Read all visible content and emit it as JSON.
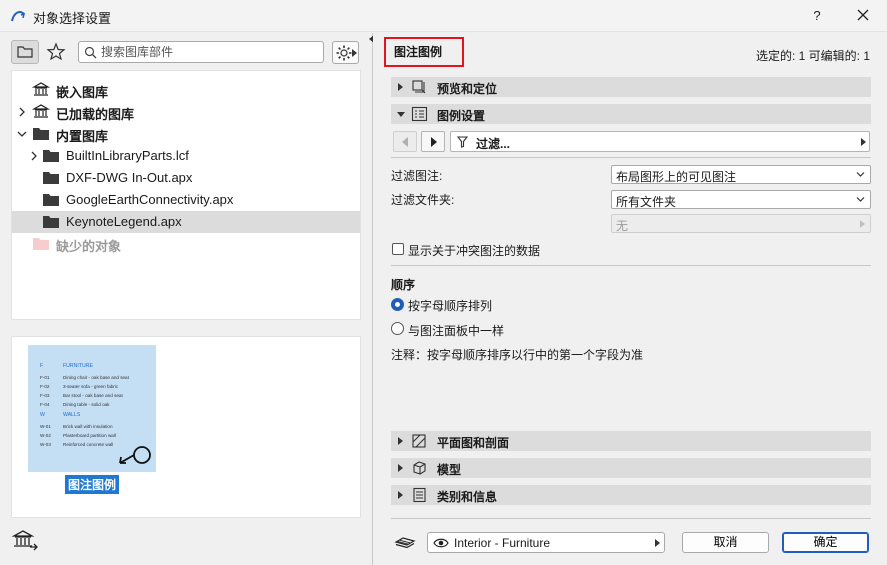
{
  "window": {
    "title": "对象选择设置",
    "help_label": "?"
  },
  "search": {
    "placeholder": "搜索图库部件"
  },
  "tree": {
    "items": [
      {
        "label": "嵌入图库",
        "style": "bold"
      },
      {
        "label": "已加载的图库",
        "style": "bold"
      },
      {
        "label": "内置图库",
        "style": "bold"
      },
      {
        "label": "BuiltInLibraryParts.lcf",
        "style": "normal"
      },
      {
        "label": "DXF-DWG In-Out.apx",
        "style": "normal"
      },
      {
        "label": "GoogleEarthConnectivity.apx",
        "style": "normal"
      },
      {
        "label": "KeynoteLegend.apx",
        "style": "normal"
      },
      {
        "label": "缺少的对象",
        "style": "dim"
      }
    ]
  },
  "preview": {
    "caption": "图注图例",
    "lines": [
      {
        "code": "F",
        "text": "FURNITURE",
        "heading": true
      },
      {
        "code": "F-01",
        "text": "Dining chair - oak base and seat",
        "heading": false
      },
      {
        "code": "F-02",
        "text": "3-seater sofa - green fabric",
        "heading": false
      },
      {
        "code": "F-03",
        "text": "Bar stool - oak base and seat",
        "heading": false
      },
      {
        "code": "F-04",
        "text": "Dining table - solid oak",
        "heading": false
      },
      {
        "code": "W",
        "text": "WALLS",
        "heading": true
      },
      {
        "code": "W-01",
        "text": "Brick wall with insulation",
        "heading": false
      },
      {
        "code": "W-02",
        "text": "Plasterboard partition wall",
        "heading": false
      },
      {
        "code": "W-03",
        "text": "Reinforced concrete wall",
        "heading": false
      }
    ]
  },
  "right": {
    "object_title": "图注图例",
    "status": "选定的: 1 可编辑的: 1",
    "sections": {
      "preview_position": "预览和定位",
      "legend_settings": "图例设置",
      "plan_section": "平面图和剖面",
      "model": "模型",
      "category_info": "类别和信息"
    },
    "filter_label": "过滤...",
    "filter_notes_label": "过滤图注:",
    "filter_notes_value": "布局图形上的可见图注",
    "filter_folder_label": "过滤文件夹:",
    "filter_folder_value": "所有文件夹",
    "sub_folder_value": "无",
    "show_conflict_label": "显示关于冲突图注的数据",
    "order_heading": "顺序",
    "order_alpha": "按字母顺序排列",
    "order_panel": "与图注面板中一样",
    "note": "注释：按字母顺序排序以行中的第一个字段为准"
  },
  "footer": {
    "layer": "Interior - Furniture",
    "cancel": "取消",
    "ok": "确定"
  },
  "colors": {
    "accent": "#1f5fb8",
    "highlight_red": "#e0151f",
    "thumb_bg": "#c4def4"
  }
}
